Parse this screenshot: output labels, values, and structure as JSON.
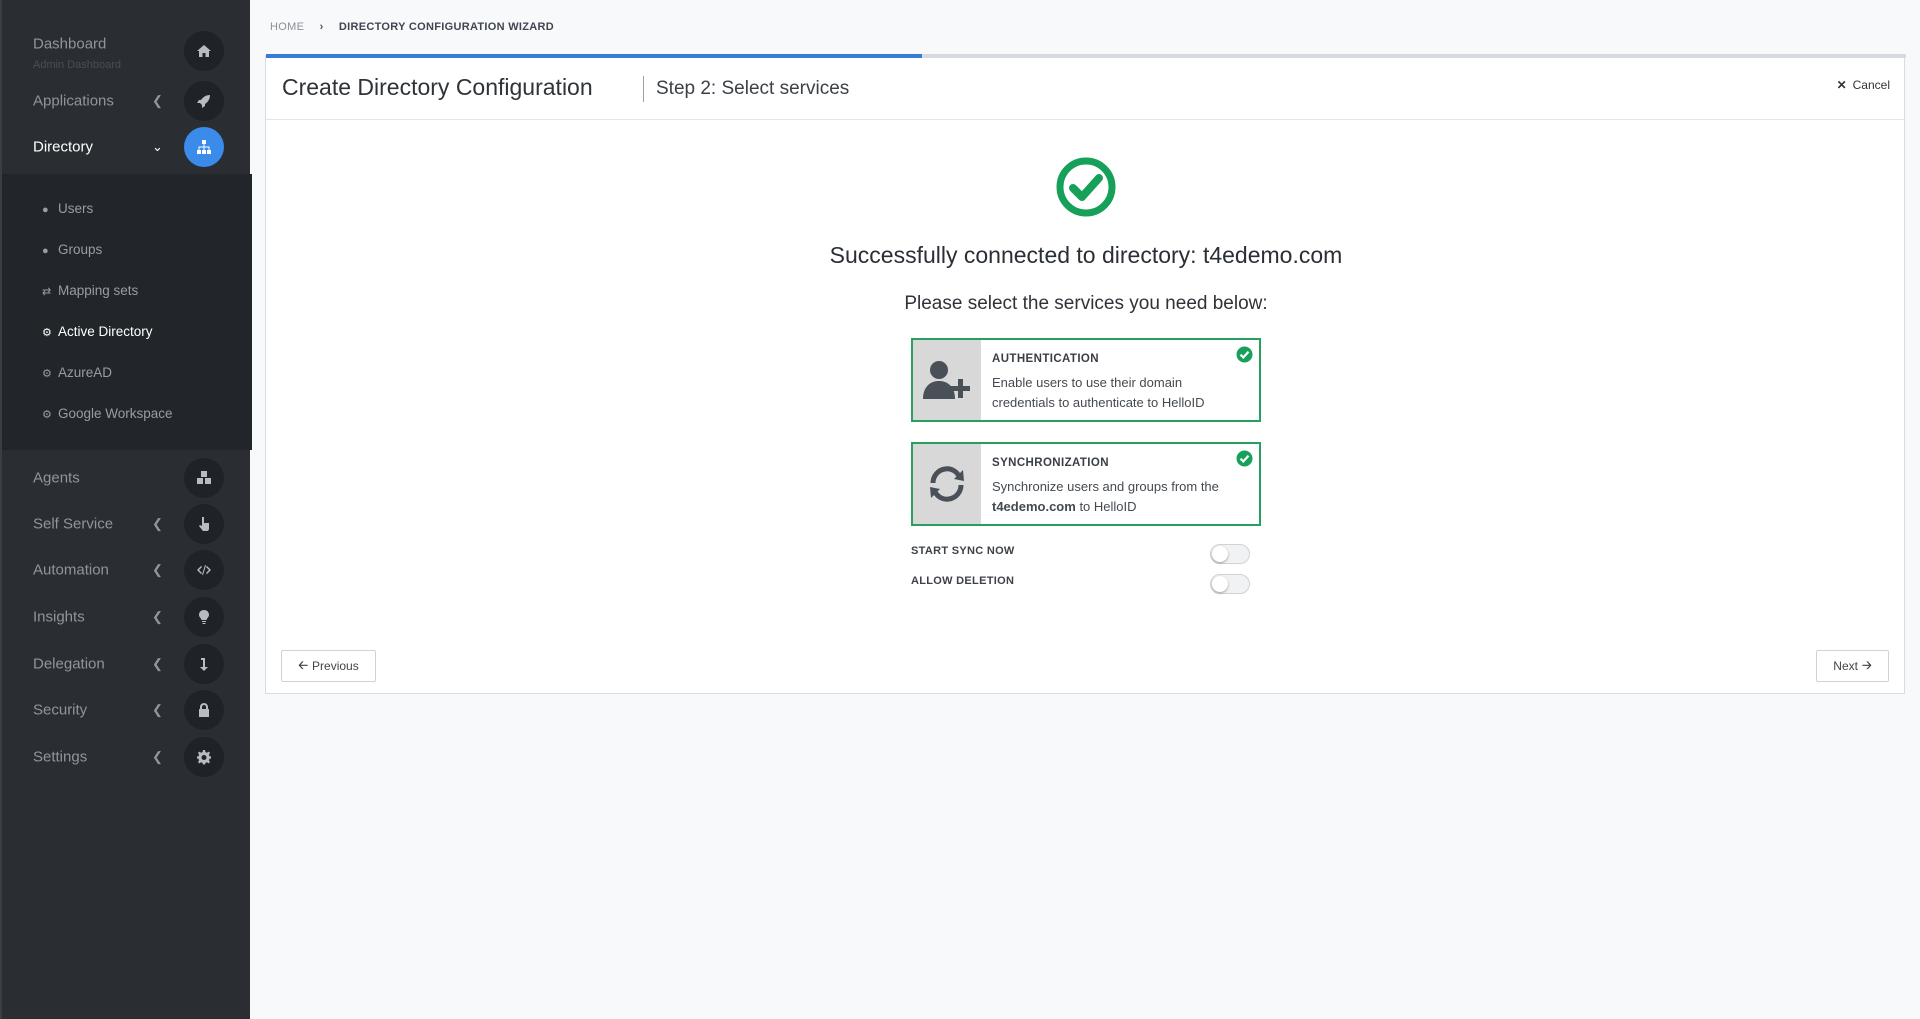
{
  "sidebar": {
    "items": [
      {
        "label": "Dashboard",
        "sub": "Admin Dashboard",
        "icon": "home-icon"
      },
      {
        "label": "Applications",
        "icon": "rocket-icon"
      },
      {
        "label": "Directory",
        "icon": "sitemap-icon"
      },
      {
        "label": "Agents",
        "icon": "cubes-icon"
      },
      {
        "label": "Self Service",
        "icon": "hand-pointer-icon"
      },
      {
        "label": "Automation",
        "icon": "code-icon"
      },
      {
        "label": "Insights",
        "icon": "lightbulb-icon"
      },
      {
        "label": "Delegation",
        "icon": "level-down-icon"
      },
      {
        "label": "Security",
        "icon": "lock-icon"
      },
      {
        "label": "Settings",
        "icon": "gear-icon"
      }
    ],
    "directory_sub": [
      {
        "label": "Users",
        "icon": "user-icon"
      },
      {
        "label": "Groups",
        "icon": "users-icon"
      },
      {
        "label": "Mapping sets",
        "icon": "exchange-icon"
      },
      {
        "label": "Active Directory",
        "icon": "gear-icon"
      },
      {
        "label": "AzureAD",
        "icon": "gear-icon"
      },
      {
        "label": "Google Workspace",
        "icon": "gear-icon"
      }
    ],
    "active_color": "#3a8bea"
  },
  "breadcrumb": {
    "home": "HOME",
    "current": "DIRECTORY CONFIGURATION WIZARD"
  },
  "wizard": {
    "title": "Create Directory Configuration",
    "step": "Step 2: Select services",
    "cancel": "Cancel",
    "progress_percent": 40,
    "success_title": "Successfully connected to directory: t4edemo.com",
    "prompt": "Please select the services you need below:",
    "services": {
      "authentication": {
        "title": "AUTHENTICATION",
        "desc": "Enable users to use their domain credentials to authenticate to HelloID",
        "selected": true
      },
      "synchronization": {
        "title": "SYNCHRONIZATION",
        "desc_before": "Synchronize users and groups from the",
        "domain": "t4edemo.com",
        "desc_after": "to HelloID",
        "selected": true
      }
    },
    "options": {
      "start_sync": {
        "label": "START SYNC NOW",
        "on": false
      },
      "allow_deletion": {
        "label": "ALLOW DELETION",
        "on": false
      }
    },
    "previous": "Previous",
    "next": "Next",
    "success_color": "#16a05a"
  }
}
